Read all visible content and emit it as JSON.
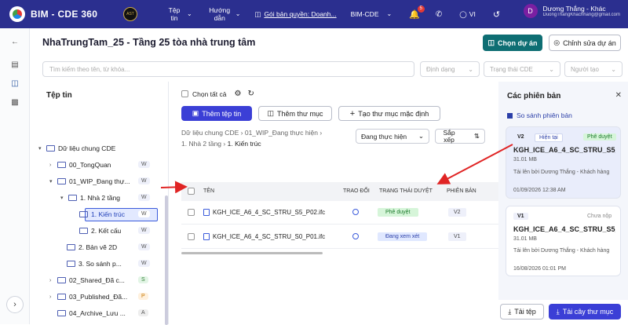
{
  "topbar": {
    "app_name": "BIM - CDE 360",
    "logo_text": "AST",
    "nav_files": "Tệp tin",
    "nav_guide": "Hướng dẫn",
    "license": "Gói bản quyền: Doanh...",
    "module": "BIM-CDE",
    "notif_count": "5",
    "lang": "VI",
    "user_initial": "D",
    "user_name": "Dương Thắng - Khác",
    "user_email": "DuongThangKhachhang@gmail.com"
  },
  "page": {
    "title": "NhaTrungTam_25 - Tầng 25 tòa nhà trung tâm",
    "choose_project": "Chọn dự án",
    "edit_project": "Chỉnh sửa dự án",
    "search_placeholder": "Tìm kiếm theo tên, từ khóa...",
    "filter_format": "Định dạng",
    "filter_cde": "Trạng thái CDE",
    "filter_creator": "Người tạo"
  },
  "tree": {
    "title": "Tệp tin",
    "items": [
      {
        "label": "Dữ liệu chung CDE",
        "tag": ""
      },
      {
        "label": "00_TongQuan",
        "tag": "W"
      },
      {
        "label": "01_WIP_Đang thự...",
        "tag": "W"
      },
      {
        "label": "1. Nhà 2 tầng",
        "tag": "W"
      },
      {
        "label": "1. Kiến trúc",
        "tag": "W"
      },
      {
        "label": "2. Kết cấu",
        "tag": "W"
      },
      {
        "label": "2. Bản vẽ 2D",
        "tag": "W"
      },
      {
        "label": "3. So sánh p...",
        "tag": "W"
      },
      {
        "label": "02_Shared_Đã c...",
        "tag": "S"
      },
      {
        "label": "03_Published_Đã...",
        "tag": "P"
      },
      {
        "label": "04_Archive_Lưu ...",
        "tag": "A"
      }
    ]
  },
  "center": {
    "select_all": "Chọn tất cả",
    "add_file": "Thêm tệp tin",
    "add_folder": "Thêm thư mục",
    "create_default": "Tạo thư mục mặc định",
    "crumb1": "Dữ liệu chung CDE",
    "crumb2": "01_WIP_Đang thực hiện",
    "crumb3": "1. Nhà 2 tầng",
    "crumb4": "1. Kiến trúc",
    "state_select": "Đang thực hiện",
    "sort": "Sắp xếp",
    "columns": {
      "name": "TÊN",
      "chat": "TRAO ĐỔI",
      "status": "TRẠNG THÁI DUYỆT",
      "version": "PHIÊN BẢN"
    },
    "rows": [
      {
        "name": "KGH_ICE_A6_4_SC_STRU_S5_P02.ifc",
        "status": "Phê duyệt",
        "version": "V2"
      },
      {
        "name": "KGH_ICE_A6_4_SC_STRU_S0_P01.ifc",
        "status": "Đang xem xét",
        "version": "V1"
      }
    ]
  },
  "versions": {
    "title": "Các phiên bản",
    "compare": "So sánh phiên bản",
    "cards": [
      {
        "v": "V2",
        "current": "Hiện tại",
        "state": "Phê duyệt",
        "file": "KGH_ICE_A6_4_SC_STRU_S5_...",
        "size": "31.01 MB",
        "uploader": "Tải lên bởi Dương Thắng - Khách hàng",
        "time": "01/09/2026 12:38 AM"
      },
      {
        "v": "V1",
        "current": "",
        "state": "Chưa nộp",
        "file": "KGH_ICE_A6_4_SC_STRU_S5_...",
        "size": "31.01 MB",
        "uploader": "Tải lên bởi Dương Thắng - Khách hàng",
        "time": "16/08/2026 01:01 PM"
      }
    ],
    "download_file": "Tải tệp",
    "download_folder": "Tải cây thư mục"
  }
}
